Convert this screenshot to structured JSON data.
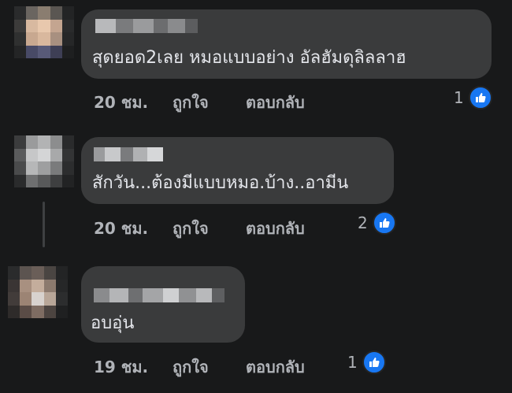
{
  "comments": [
    {
      "text": "สุดยอด2เลย หมอแบบอย่าง อัลฮัมดุลิลลาฮ",
      "time": "20 ชม.",
      "like_label": "ถูกใจ",
      "reply_label": "ตอบกลับ",
      "reaction_count": "1",
      "reaction_icon": "thumbs-up-icon",
      "reaction_color": "#1877f2"
    },
    {
      "text": "สักวัน...ต้องมีแบบหมอ.บ้าง..อามีน",
      "time": "20 ชม.",
      "like_label": "ถูกใจ",
      "reply_label": "ตอบกลับ",
      "reaction_count": "2",
      "reaction_icon": "thumbs-up-icon",
      "reaction_color": "#1877f2"
    },
    {
      "text": "อบอุ่น",
      "time": "19 ชม.",
      "like_label": "ถูกใจ",
      "reply_label": "ตอบกลับ",
      "reaction_count": "1",
      "reaction_icon": "thumbs-up-icon",
      "reaction_color": "#1877f2"
    }
  ],
  "colors": {
    "background": "#18191a",
    "bubble": "#3a3b3c",
    "text": "#e4e6eb",
    "secondary_text": "#b0b3b8",
    "accent": "#1877f2"
  }
}
